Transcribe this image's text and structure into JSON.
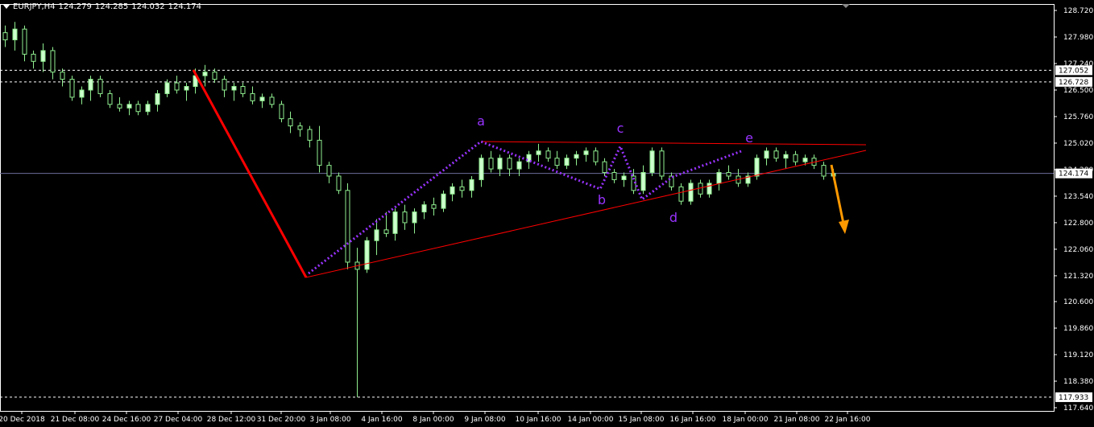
{
  "header": {
    "symbol": "EURJPY,H4",
    "open": "124.279",
    "high": "124.285",
    "low": "124.032",
    "close": "124.174"
  },
  "colors": {
    "background": "#000000",
    "axis": "#ffffff",
    "bull_candle": "#ccffcc",
    "bear_candle": "#000000",
    "wick": "#90ee90",
    "trendline": "#ff0000",
    "wave_path": "#9933ff",
    "wave_label": "#9933ff",
    "arrow": "#ff9900",
    "bid_line": "#6c6c9c",
    "dashed_level": "#ffffff",
    "price_tag_bg": "#ffffff",
    "price_tag_fg": "#000000"
  },
  "chart_data": {
    "type": "candlestick",
    "timeframe": "H4",
    "ylim": [
      117.64,
      128.72
    ],
    "y_ticks": [
      "128.720",
      "127.980",
      "127.240",
      "126.500",
      "125.760",
      "125.020",
      "124.280",
      "123.540",
      "122.800",
      "122.060",
      "121.320",
      "120.600",
      "119.860",
      "119.120",
      "118.380",
      "117.640"
    ],
    "x_ticks": [
      "20 Dec 2018",
      "21 Dec 08:00",
      "24 Dec 16:00",
      "27 Dec 04:00",
      "28 Dec 12:00",
      "31 Dec 20:00",
      "3 Jan 08:00",
      "4 Jan 16:00",
      "8 Jan 00:00",
      "9 Jan 08:00",
      "10 Jan 16:00",
      "14 Jan 00:00",
      "15 Jan 08:00",
      "16 Jan 16:00",
      "18 Jan 00:00",
      "21 Jan 08:00",
      "22 Jan 16:00"
    ],
    "current_price": "124.174",
    "levels": [
      {
        "value": 127.052,
        "label": "127.052"
      },
      {
        "value": 126.728,
        "label": "126.728"
      },
      {
        "value": 117.933,
        "label": "117.933"
      }
    ],
    "wave_labels": [
      "a",
      "b",
      "c",
      "d",
      "e"
    ],
    "anchors": [
      {
        "o": 128.1,
        "h": 128.3,
        "l": 127.7,
        "c": 127.9
      },
      {
        "o": 127.9,
        "h": 128.4,
        "l": 127.6,
        "c": 128.2
      },
      {
        "o": 128.2,
        "h": 128.3,
        "l": 127.3,
        "c": 127.5
      },
      {
        "o": 127.5,
        "h": 127.6,
        "l": 127.1,
        "c": 127.3
      },
      {
        "o": 127.3,
        "h": 127.8,
        "l": 127.0,
        "c": 127.6
      },
      {
        "o": 127.6,
        "h": 127.7,
        "l": 126.8,
        "c": 127.0
      },
      {
        "o": 127.0,
        "h": 127.1,
        "l": 126.6,
        "c": 126.8
      },
      {
        "o": 126.8,
        "h": 126.9,
        "l": 126.2,
        "c": 126.3
      },
      {
        "o": 126.3,
        "h": 126.6,
        "l": 126.1,
        "c": 126.5
      },
      {
        "o": 126.5,
        "h": 126.9,
        "l": 126.2,
        "c": 126.8
      },
      {
        "o": 126.8,
        "h": 126.9,
        "l": 126.3,
        "c": 126.4
      },
      {
        "o": 126.4,
        "h": 126.5,
        "l": 126.0,
        "c": 126.1
      },
      {
        "o": 126.1,
        "h": 126.3,
        "l": 125.9,
        "c": 126.0
      },
      {
        "o": 126.0,
        "h": 126.2,
        "l": 125.8,
        "c": 126.1
      },
      {
        "o": 126.1,
        "h": 126.2,
        "l": 125.8,
        "c": 125.9
      },
      {
        "o": 125.9,
        "h": 126.2,
        "l": 125.8,
        "c": 126.1
      },
      {
        "o": 126.1,
        "h": 126.5,
        "l": 125.9,
        "c": 126.4
      },
      {
        "o": 126.4,
        "h": 126.8,
        "l": 126.3,
        "c": 126.7
      },
      {
        "o": 126.7,
        "h": 126.9,
        "l": 126.4,
        "c": 126.5
      },
      {
        "o": 126.5,
        "h": 126.7,
        "l": 126.2,
        "c": 126.6
      },
      {
        "o": 126.6,
        "h": 127.1,
        "l": 126.4,
        "c": 126.9
      },
      {
        "o": 126.9,
        "h": 127.2,
        "l": 126.6,
        "c": 127.0
      },
      {
        "o": 127.0,
        "h": 127.1,
        "l": 126.7,
        "c": 126.8
      },
      {
        "o": 126.8,
        "h": 126.9,
        "l": 126.3,
        "c": 126.5
      },
      {
        "o": 126.5,
        "h": 126.7,
        "l": 126.2,
        "c": 126.6
      },
      {
        "o": 126.6,
        "h": 126.7,
        "l": 126.3,
        "c": 126.4
      },
      {
        "o": 126.4,
        "h": 126.6,
        "l": 126.1,
        "c": 126.2
      },
      {
        "o": 126.2,
        "h": 126.4,
        "l": 126.0,
        "c": 126.3
      },
      {
        "o": 126.3,
        "h": 126.4,
        "l": 126.0,
        "c": 126.1
      },
      {
        "o": 126.1,
        "h": 126.2,
        "l": 125.6,
        "c": 125.7
      },
      {
        "o": 125.7,
        "h": 125.9,
        "l": 125.3,
        "c": 125.5
      },
      {
        "o": 125.5,
        "h": 125.6,
        "l": 125.2,
        "c": 125.4
      },
      {
        "o": 125.4,
        "h": 125.5,
        "l": 124.9,
        "c": 125.1
      },
      {
        "o": 125.1,
        "h": 125.5,
        "l": 124.2,
        "c": 124.4
      },
      {
        "o": 124.4,
        "h": 124.5,
        "l": 123.9,
        "c": 124.1
      },
      {
        "o": 124.1,
        "h": 124.2,
        "l": 123.6,
        "c": 123.7
      },
      {
        "o": 123.7,
        "h": 123.9,
        "l": 121.5,
        "c": 121.7
      },
      {
        "o": 121.7,
        "h": 122.1,
        "l": 117.933,
        "c": 121.5
      },
      {
        "o": 121.5,
        "h": 122.4,
        "l": 121.4,
        "c": 122.3
      },
      {
        "o": 122.3,
        "h": 122.9,
        "l": 121.9,
        "c": 122.6
      },
      {
        "o": 122.6,
        "h": 123.1,
        "l": 122.4,
        "c": 122.5
      },
      {
        "o": 122.5,
        "h": 123.2,
        "l": 122.3,
        "c": 123.1
      },
      {
        "o": 123.1,
        "h": 123.3,
        "l": 122.6,
        "c": 122.8
      },
      {
        "o": 122.8,
        "h": 123.2,
        "l": 122.5,
        "c": 123.1
      },
      {
        "o": 123.1,
        "h": 123.4,
        "l": 122.9,
        "c": 123.3
      },
      {
        "o": 123.3,
        "h": 123.5,
        "l": 123.0,
        "c": 123.2
      },
      {
        "o": 123.2,
        "h": 123.7,
        "l": 123.1,
        "c": 123.6
      },
      {
        "o": 123.6,
        "h": 123.9,
        "l": 123.4,
        "c": 123.8
      },
      {
        "o": 123.8,
        "h": 124.0,
        "l": 123.5,
        "c": 123.7
      },
      {
        "o": 123.7,
        "h": 124.1,
        "l": 123.5,
        "c": 124.0
      },
      {
        "o": 124.0,
        "h": 124.7,
        "l": 123.8,
        "c": 124.6
      },
      {
        "o": 124.6,
        "h": 124.8,
        "l": 124.2,
        "c": 124.3
      },
      {
        "o": 124.3,
        "h": 124.7,
        "l": 124.1,
        "c": 124.6
      },
      {
        "o": 124.6,
        "h": 124.7,
        "l": 124.1,
        "c": 124.3
      },
      {
        "o": 124.3,
        "h": 124.6,
        "l": 124.1,
        "c": 124.5
      },
      {
        "o": 124.5,
        "h": 124.8,
        "l": 124.3,
        "c": 124.7
      },
      {
        "o": 124.7,
        "h": 125.0,
        "l": 124.5,
        "c": 124.8
      },
      {
        "o": 124.8,
        "h": 124.9,
        "l": 124.5,
        "c": 124.6
      },
      {
        "o": 124.6,
        "h": 124.8,
        "l": 124.3,
        "c": 124.4
      },
      {
        "o": 124.4,
        "h": 124.7,
        "l": 124.3,
        "c": 124.6
      },
      {
        "o": 124.6,
        "h": 124.8,
        "l": 124.4,
        "c": 124.7
      },
      {
        "o": 124.7,
        "h": 124.9,
        "l": 124.5,
        "c": 124.8
      },
      {
        "o": 124.8,
        "h": 124.9,
        "l": 124.4,
        "c": 124.5
      },
      {
        "o": 124.5,
        "h": 124.6,
        "l": 124.1,
        "c": 124.2
      },
      {
        "o": 124.2,
        "h": 124.3,
        "l": 123.9,
        "c": 124.0
      },
      {
        "o": 124.0,
        "h": 124.2,
        "l": 123.8,
        "c": 124.1
      },
      {
        "o": 124.1,
        "h": 124.3,
        "l": 123.6,
        "c": 123.7
      },
      {
        "o": 123.7,
        "h": 124.4,
        "l": 123.6,
        "c": 124.2
      },
      {
        "o": 124.2,
        "h": 124.9,
        "l": 124.1,
        "c": 124.8
      },
      {
        "o": 124.8,
        "h": 124.9,
        "l": 124.0,
        "c": 124.1
      },
      {
        "o": 124.1,
        "h": 124.2,
        "l": 123.7,
        "c": 123.8
      },
      {
        "o": 123.8,
        "h": 123.9,
        "l": 123.3,
        "c": 123.4
      },
      {
        "o": 123.4,
        "h": 124.0,
        "l": 123.3,
        "c": 123.9
      },
      {
        "o": 123.9,
        "h": 124.0,
        "l": 123.5,
        "c": 123.6
      },
      {
        "o": 123.6,
        "h": 124.0,
        "l": 123.5,
        "c": 123.9
      },
      {
        "o": 123.9,
        "h": 124.3,
        "l": 123.7,
        "c": 124.2
      },
      {
        "o": 124.2,
        "h": 124.4,
        "l": 124.0,
        "c": 124.1
      },
      {
        "o": 124.1,
        "h": 124.3,
        "l": 123.8,
        "c": 123.9
      },
      {
        "o": 123.9,
        "h": 124.2,
        "l": 123.8,
        "c": 124.1
      },
      {
        "o": 124.1,
        "h": 124.7,
        "l": 124.0,
        "c": 124.6
      },
      {
        "o": 124.6,
        "h": 124.9,
        "l": 124.4,
        "c": 124.8
      },
      {
        "o": 124.8,
        "h": 124.9,
        "l": 124.5,
        "c": 124.6
      },
      {
        "o": 124.6,
        "h": 124.8,
        "l": 124.3,
        "c": 124.7
      },
      {
        "o": 124.7,
        "h": 124.8,
        "l": 124.4,
        "c": 124.5
      },
      {
        "o": 124.5,
        "h": 124.7,
        "l": 124.4,
        "c": 124.6
      },
      {
        "o": 124.6,
        "h": 124.7,
        "l": 124.3,
        "c": 124.4
      },
      {
        "o": 124.4,
        "h": 124.5,
        "l": 124.0,
        "c": 124.1
      },
      {
        "o": 124.1,
        "h": 124.3,
        "l": 124.0,
        "c": 124.174
      }
    ]
  }
}
